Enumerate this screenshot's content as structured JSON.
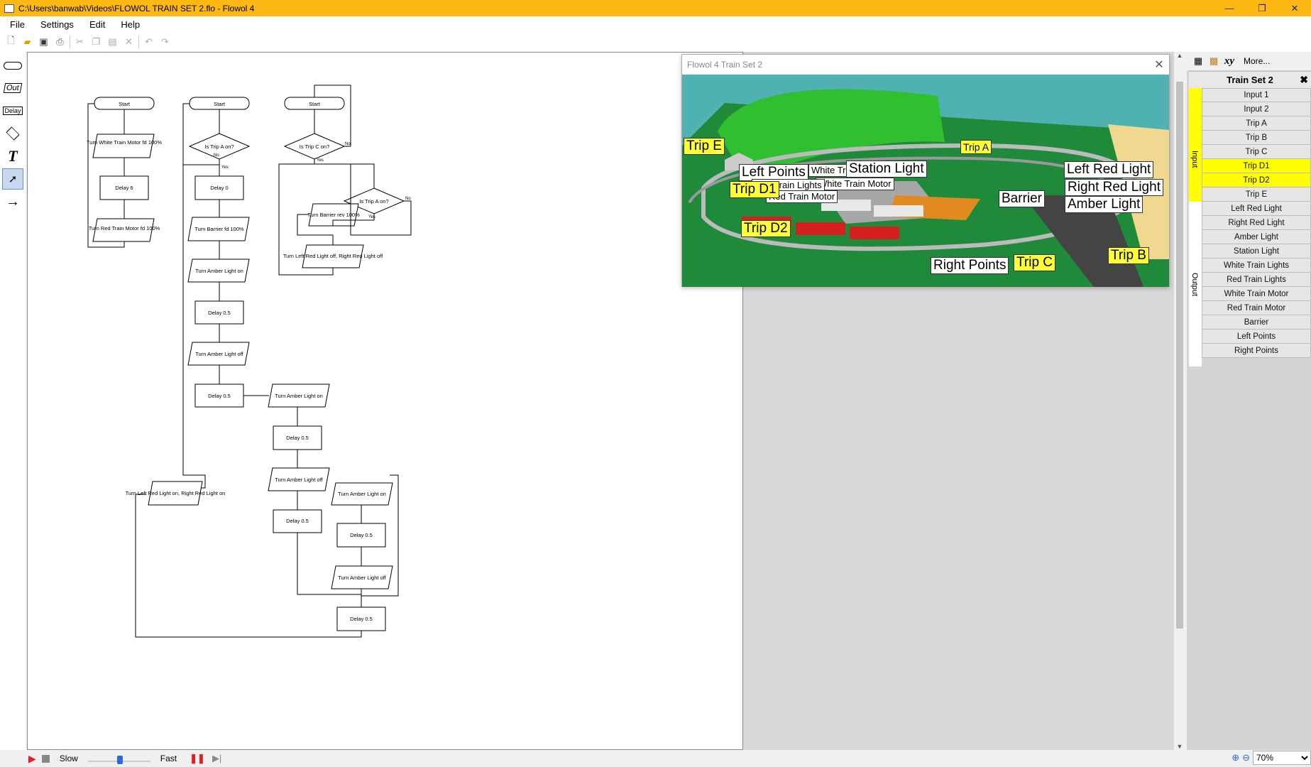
{
  "window": {
    "title": "C:\\Users\\banwab\\Videos\\FLOWOL TRAIN SET 2.flo - Flowol 4",
    "minimize": "—",
    "maximize": "❐",
    "close": "✕"
  },
  "menu": [
    "File",
    "Settings",
    "Edit",
    "Help"
  ],
  "palette": {
    "out": "Out",
    "delay": "Delay",
    "text": "T",
    "arrow": "→"
  },
  "flowchart": {
    "c1": [
      "Start",
      "Turn White Train Motor fd 100%",
      "Delay 6",
      "Turn Red Train Motor fd 100%"
    ],
    "c2": [
      "Start",
      "Is Trip A on?",
      "Delay 0",
      "Turn Barrier fd 100%",
      "Turn Amber Light on",
      "Delay 0.5",
      "Turn Amber Light off",
      "Delay 0.5",
      "Turn Left Red Light on, Right Red Light on"
    ],
    "c3": [
      "Start",
      "Is Trip C on?",
      "Is Trip A on?",
      "Turn Barrier rev 100%",
      "Turn Left Red Light off, Right Red Light off"
    ],
    "c4": [
      "Turn Amber Light on",
      "Delay 0.5",
      "Turn Amber Light off",
      "Delay 0.5"
    ],
    "c5": [
      "Turn Amber Light on",
      "Delay 0.5",
      "Turn Amber Light off",
      "Delay 0.5"
    ],
    "yes": "Yes",
    "no": "No"
  },
  "simulation": {
    "title": "Flowol 4 Train Set 2",
    "close": "✕",
    "labels": {
      "trip_e": "Trip E",
      "trip_a": "Trip A",
      "left_points": "Left Points",
      "white_train_lights": "White Train Lights",
      "station_light": "Station Light",
      "red_train_lights": "Red Train Lights",
      "white_train_motor": "White Train Motor",
      "red_train_motor": "Red Train Motor",
      "trip_d1": "Trip D1",
      "trip_d2": "Trip D2",
      "left_red_light": "Left Red Light",
      "right_red_light": "Right Red Light",
      "amber_light": "Amber Light",
      "barrier": "Barrier",
      "right_points": "Right Points",
      "trip_c": "Trip C",
      "trip_b": "Trip B"
    }
  },
  "panel": {
    "more": "More...",
    "xy": "xy",
    "title": "Train Set 2",
    "input_label": "Input",
    "output_label": "Output",
    "inputs": [
      "Input 1",
      "Input 2",
      "Trip A",
      "Trip B",
      "Trip C",
      "Trip D1",
      "Trip D2",
      "Trip E"
    ],
    "outputs": [
      "Left Red Light",
      "Right Red Light",
      "Amber Light",
      "Station Light",
      "White Train Lights",
      "Red Train Lights",
      "White Train Motor",
      "Red Train Motor",
      "Barrier",
      "Left Points",
      "Right Points"
    ],
    "highlight_color": "#ffff00"
  },
  "status": {
    "slow": "Slow",
    "fast": "Fast",
    "zoom": "70%"
  }
}
